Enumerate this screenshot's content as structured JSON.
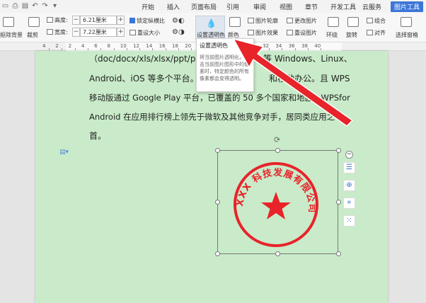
{
  "tabs": [
    "开始",
    "插入",
    "页面布局",
    "引用",
    "审阅",
    "视图",
    "章节",
    "开发工具",
    "云服务",
    "图片工具"
  ],
  "ribbon": {
    "remove_bg": "抠除背景",
    "crop": "裁剪",
    "height_label": "高度:",
    "height_value": "6.21厘米",
    "width_label": "宽度:",
    "width_value": "7.22厘米",
    "lock_ratio": "锁定纵横比",
    "reset_size": "重设大小",
    "set_transparent": "设置透明色",
    "color": "颜色",
    "picture_outline": "图片轮廓",
    "picture_effect": "图片效果",
    "change_picture": "更改图片",
    "reset_picture": "重设图片",
    "wrap": "环绕",
    "rotate": "旋转",
    "group": "组合",
    "align": "对齐",
    "select_pane": "选择窗格"
  },
  "ruler_numbers": [
    "4",
    "2",
    "2",
    "4",
    "6",
    "8",
    "10",
    "12",
    "14",
    "16",
    "18",
    "20",
    "22",
    "24",
    "26",
    "28",
    "30",
    "32",
    "34",
    "36",
    "38",
    "40"
  ],
  "tooltip": {
    "title": "设置透明色",
    "description": "将当前图片透明化，单击当前图片图形中的像素时，特定颜色的所有像素都会变得透明。"
  },
  "document": {
    "lines": [
      "（doc/docx/xls/xlsx/ppt/pptx 等",
      "Android、iOS 等多个平台。W",
      "移动版通过 Google Play 平台，已覆盖的 50 多个国家和地区，WPSfor",
      "Android 在应用排行榜上领先于微软及其他竞争对手，居同类应用之",
      "首。"
    ],
    "line1_tail": "等 Windows、Linux、",
    "line2_tail": "和移动办公。且 WPS"
  },
  "stamp": {
    "text": "XXX 科技发展有限公司",
    "color": "#e8232a"
  },
  "colors": {
    "accent": "#3b75d8",
    "page": "#c9ebc9",
    "arrow": "#e8232a"
  },
  "icons": [
    "save-icon",
    "print-icon",
    "undo-icon",
    "redo-icon",
    "rotate-handle-icon",
    "layout-icon",
    "zoom-icon",
    "crop-icon",
    "more-icon",
    "paragraph-icon"
  ]
}
